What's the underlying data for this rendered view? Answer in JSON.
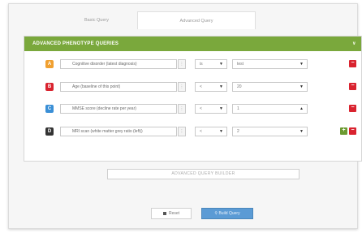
{
  "tabs": [
    {
      "label": "Basic Query"
    },
    {
      "label": "Advanced Query"
    }
  ],
  "panel": {
    "title": "ADVANCED PHENOTYPE QUERIES",
    "collapse_icon": "chevron-down-icon"
  },
  "rows": [
    {
      "badge": "A",
      "badge_color": "#f0a030",
      "field": "Cognitive disorder (latest diagnosis)",
      "operator": "is",
      "value": "test"
    },
    {
      "badge": "B",
      "badge_color": "#d9232f",
      "field": "Age (baseline of this point)",
      "operator": "<",
      "value": "20"
    },
    {
      "badge": "C",
      "badge_color": "#3a8fd6",
      "field": "MMSE score (decline rate per year)",
      "operator": "<",
      "value": "1"
    },
    {
      "badge": "D",
      "badge_color": "#333333",
      "field": "MRI scan (white matter grey ratio (left))",
      "operator": "<",
      "value": "2"
    }
  ],
  "actions": {
    "advanced_button": "ADVANCED QUERY BUILDER",
    "reset": "Reset",
    "build": "Build Query"
  },
  "colors": {
    "header_green": "#7aa83c",
    "remove_red": "#d9232f",
    "add_green": "#6b9a30",
    "primary_blue": "#5b9bd5"
  }
}
